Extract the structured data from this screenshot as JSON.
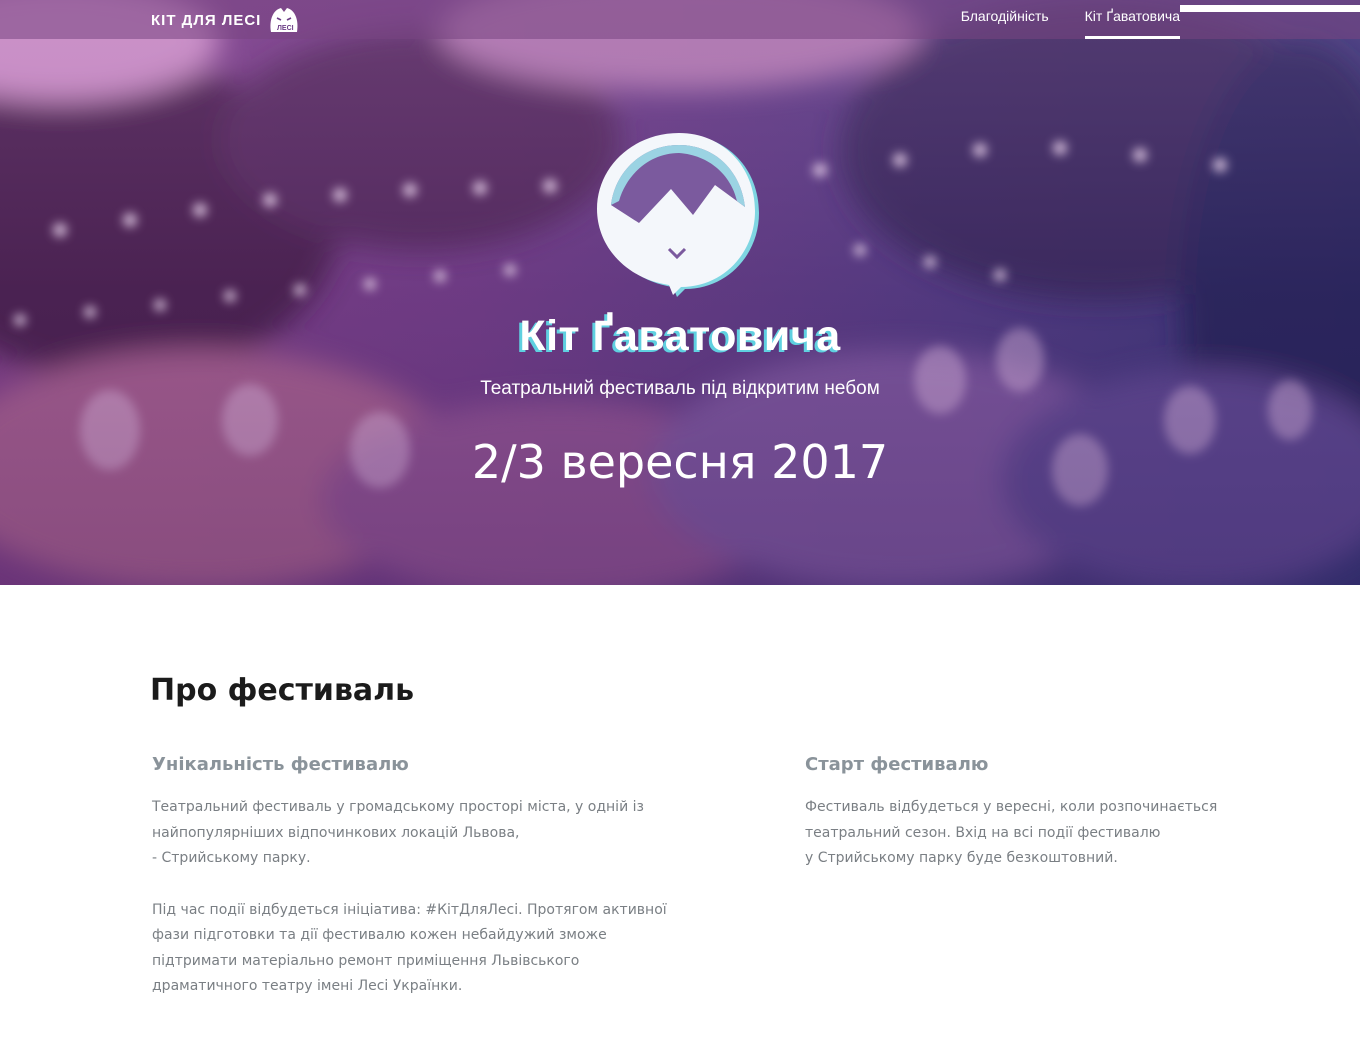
{
  "header": {
    "brand": {
      "text": "КІТ ДЛЯ ЛЕСІ",
      "badge_text": "ЛЕСІ"
    },
    "nav": [
      {
        "label": "Благодійність",
        "active": false
      },
      {
        "label": "Кіт Ґаватовича",
        "active": true
      }
    ]
  },
  "hero": {
    "logo_icon": "mountain-speech-bubble-logo",
    "title": "Кіт Ґаватовича",
    "subtitle": "Театральний фестиваль під відкритим небом",
    "date": "2/3 вересня 2017"
  },
  "about": {
    "title": "Про фестиваль",
    "columns": [
      {
        "heading": "Унікальність фестивалю",
        "paragraphs": [
          [
            "Театральний фестиваль у громадському просторі міста, у одній із",
            "найпопулярніших відпочинкових локацій Львова,",
            "- Стрийському парку."
          ],
          [
            "Під час події відбудеться ініціатива: #КітДляЛесі. Протягом активної",
            "фази підготовки та дії фестивалю кожен небайдужий зможе",
            "підтримати матеріально ремонт приміщення Львівського",
            "драматичного театру імені Лесі Українки."
          ]
        ]
      },
      {
        "heading": "Старт фестивалю",
        "paragraphs": [
          [
            "Фестиваль відбудеться у вересні, коли розпочинається",
            "театральний сезон. Вхід на всі події фестивалю",
            "у Стрийському парку буде безкоштовний."
          ]
        ]
      }
    ]
  },
  "colors": {
    "hero_purple": "#6b3c85",
    "hero_indigo": "#2f3574",
    "title_shadow_cyan": "#5fd0e0",
    "heading_dark": "#1b1b1b",
    "subheading_gray": "#8a939a",
    "body_gray": "#7a7f84"
  }
}
